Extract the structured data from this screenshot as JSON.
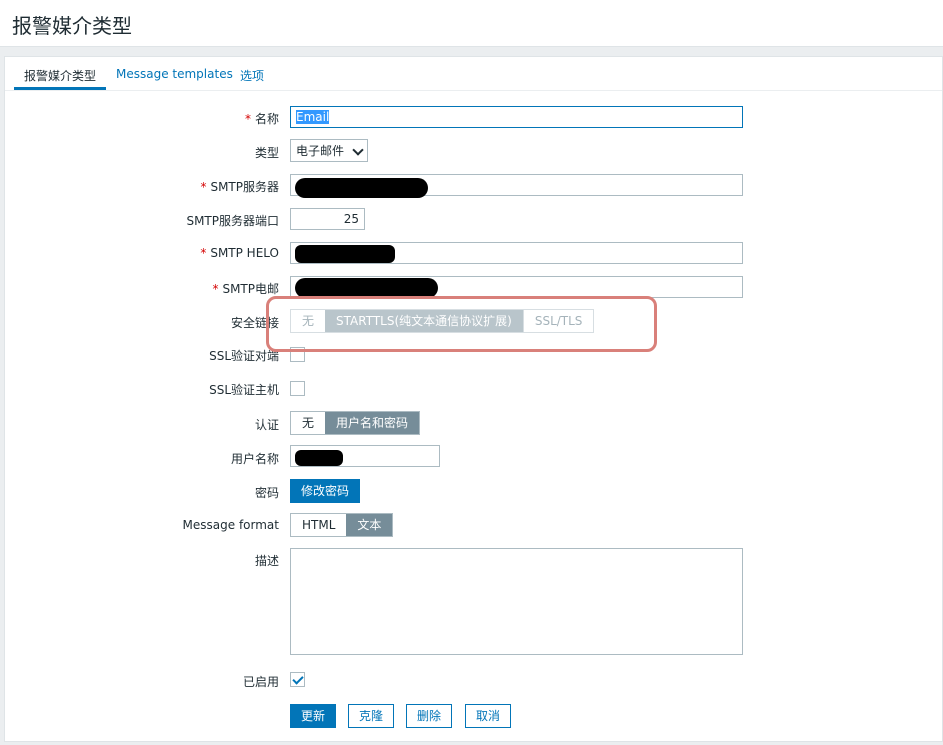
{
  "page": {
    "title": "报警媒介类型"
  },
  "tabs": [
    {
      "label": "报警媒介类型",
      "active": true
    },
    {
      "label": "Message templates",
      "active": false
    },
    {
      "label": "选项",
      "active": false
    }
  ],
  "form": {
    "name": {
      "label": "名称",
      "required": true,
      "value": "Email"
    },
    "type": {
      "label": "类型",
      "value": "电子邮件"
    },
    "smtp_server": {
      "label": "SMTP服务器",
      "required": true
    },
    "smtp_port": {
      "label": "SMTP服务器端口",
      "value": "25"
    },
    "smtp_helo": {
      "label": "SMTP HELO",
      "required": true
    },
    "smtp_email": {
      "label": "SMTP电邮",
      "required": true
    },
    "security": {
      "label": "安全链接",
      "options": [
        "无",
        "STARTTLS(纯文本通信协议扩展)",
        "SSL/TLS"
      ],
      "selected": "STARTTLS(纯文本通信协议扩展)"
    },
    "ssl_verify_peer": {
      "label": "SSL验证对端",
      "checked": false
    },
    "ssl_verify_host": {
      "label": "SSL验证主机",
      "checked": false
    },
    "auth": {
      "label": "认证",
      "options": [
        "无",
        "用户名和密码"
      ],
      "selected": "用户名和密码"
    },
    "username": {
      "label": "用户名称"
    },
    "password": {
      "label": "密码",
      "button": "修改密码"
    },
    "message_format": {
      "label": "Message format",
      "options": [
        "HTML",
        "文本"
      ],
      "selected": "文本"
    },
    "description": {
      "label": "描述",
      "value": ""
    },
    "enabled": {
      "label": "已启用",
      "checked": true
    }
  },
  "buttons": {
    "update": "更新",
    "clone": "克隆",
    "delete": "删除",
    "cancel": "取消"
  },
  "colors": {
    "accent": "#0275b8",
    "required": "#d40000",
    "segment_selected": "#768d99",
    "highlight_box": "#d9807a"
  }
}
